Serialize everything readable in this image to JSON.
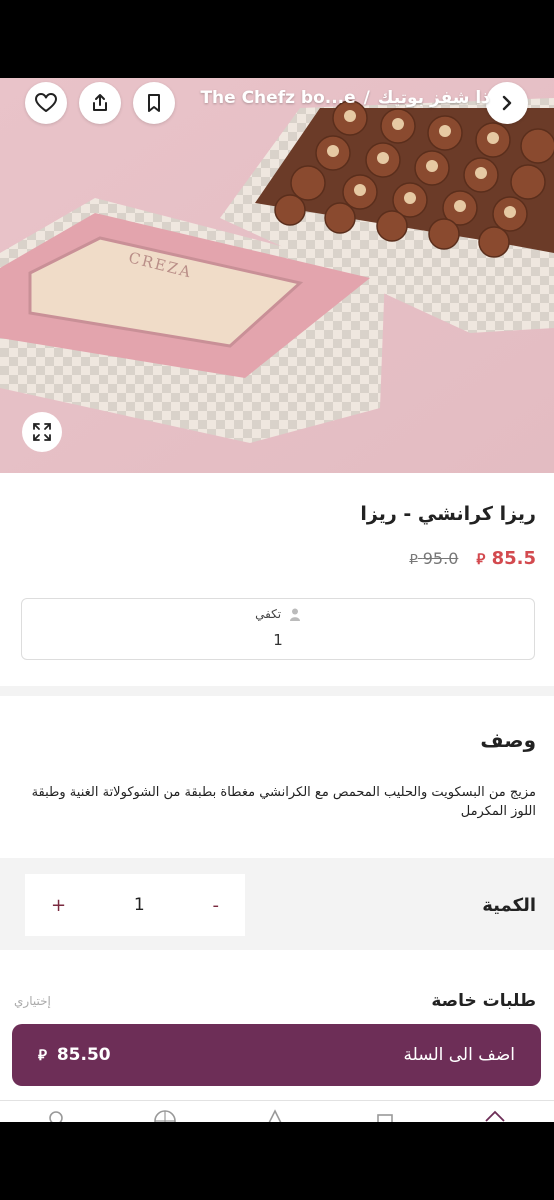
{
  "header": {
    "breadcrumb_store": "ذا شفز بوتيك",
    "breadcrumb_separator": "/",
    "breadcrumb_brand": "The Chefz bo...e",
    "icons": [
      "chevron-right-icon",
      "bookmark-icon",
      "share-icon",
      "heart-icon",
      "expand-icon"
    ]
  },
  "hero": {
    "brand_on_box": "CREZA"
  },
  "product": {
    "title": "ريزا كرانشي - ريزا",
    "price_now": "85.5",
    "price_old": "95.0",
    "currency_symbol": "⃁"
  },
  "serves": {
    "label": "تكفي",
    "value": "1"
  },
  "description": {
    "title": "وصف",
    "text": "مزيج من البسكويت والحليب المحمص مع الكرانشي مغطاة بطبقة من الشوكولاتة الغنية وطبقة اللوز المكرمل"
  },
  "quantity": {
    "label": "الكمية",
    "value": "1",
    "plus": "+",
    "minus": "-"
  },
  "special_requests": {
    "title": "طلبات خاصة",
    "optional": "إختياري"
  },
  "cart": {
    "label": "اضف الى السلة",
    "price": "85.50",
    "color": "#6d2e57"
  },
  "colors": {
    "price_now": "#d34a4f",
    "accent": "#6d2e57"
  }
}
